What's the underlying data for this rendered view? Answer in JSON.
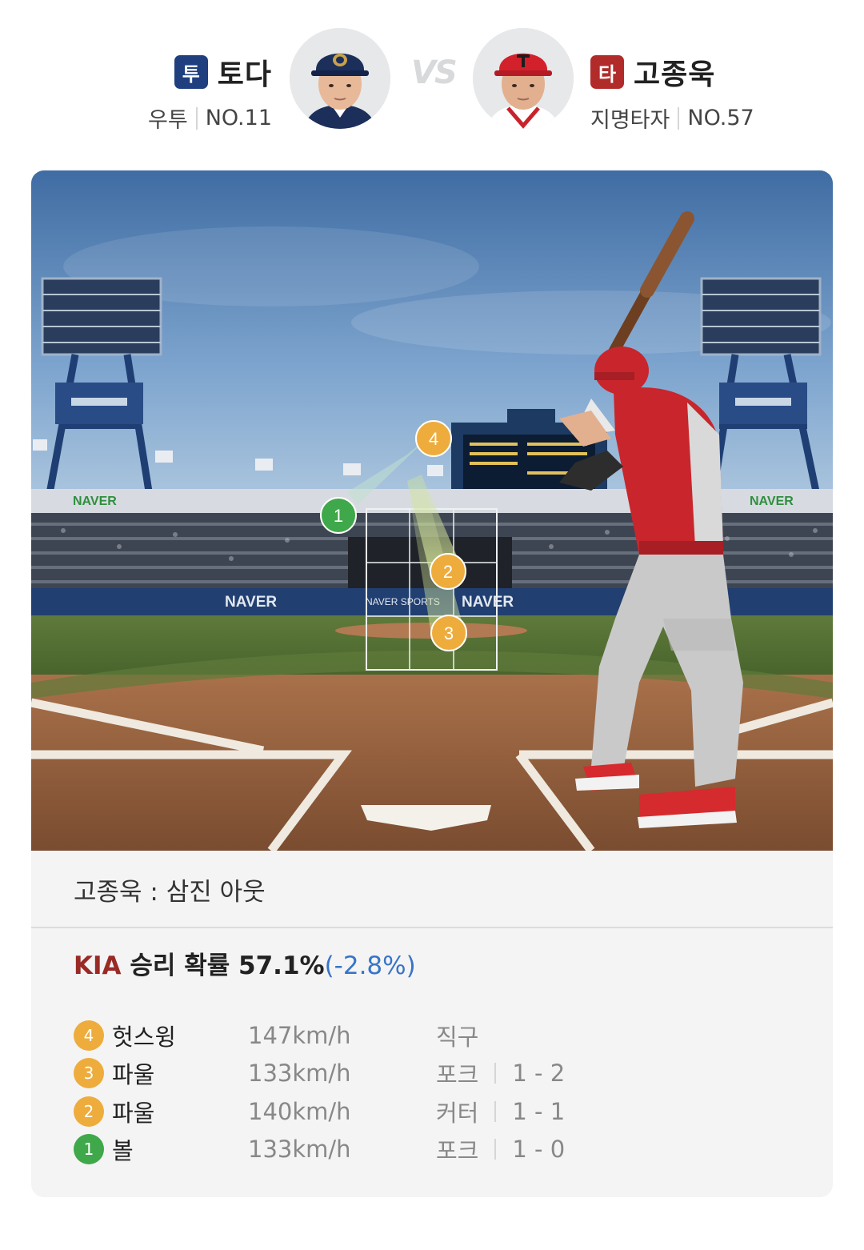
{
  "pitcher": {
    "badge": "투",
    "name": "토다",
    "hand": "우투",
    "number": "NO.11"
  },
  "vs_label": "VS",
  "batter": {
    "badge": "타",
    "name": "고종욱",
    "position": "지명타자",
    "number": "NO.57"
  },
  "field": {
    "ads": [
      "NAVER",
      "NAVER SPORTS"
    ],
    "pitch_markers": [
      "1",
      "2",
      "3",
      "4"
    ]
  },
  "result": "고종욱 : 삼진 아웃",
  "win_probability": {
    "team": "KIA",
    "label": "승리 확률 57.1%",
    "delta": "(-2.8%)"
  },
  "pitches": [
    {
      "num": "4",
      "result": "헛스윙",
      "speed": "147km/h",
      "type": "직구",
      "count": "",
      "color": "#eeac3c"
    },
    {
      "num": "3",
      "result": "파울",
      "speed": "133km/h",
      "type": "포크",
      "count": "1 - 2",
      "color": "#eeac3c"
    },
    {
      "num": "2",
      "result": "파울",
      "speed": "140km/h",
      "type": "커터",
      "count": "1 - 1",
      "color": "#eeac3c"
    },
    {
      "num": "1",
      "result": "볼",
      "speed": "133km/h",
      "type": "포크",
      "count": "1 - 0",
      "color": "#3fa84a"
    }
  ],
  "colors": {
    "pitcher_badge": "#1f3f7e",
    "batter_badge": "#b12b2b",
    "team": "#9a2a26",
    "delta": "#3874c8",
    "ball_marker": "#3fa84a",
    "strike_marker": "#eeac3c"
  }
}
